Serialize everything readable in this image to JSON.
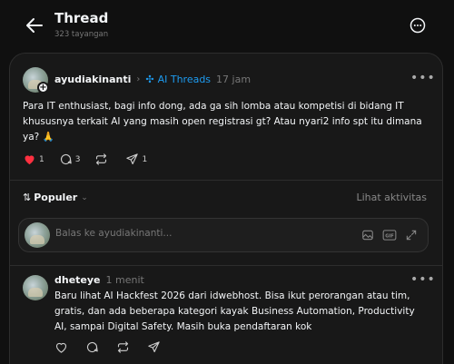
{
  "header": {
    "title": "Thread",
    "views": "323 tayangan"
  },
  "post": {
    "username": "ayudiakinanti",
    "topic": "AI Threads",
    "time": "17 jam",
    "text": "Para IT enthusiast, bagi info dong, ada ga sih lomba atau kompetisi di bidang IT khususnya terkait AI yang masih open registrasi gt? Atau nyari2 info spt itu dimana ya? 🙏",
    "likes": "1",
    "comments": "3",
    "shares": "1",
    "liked": true
  },
  "sort": {
    "label": "Populer",
    "activity": "Lihat aktivitas"
  },
  "reply_box": {
    "placeholder": "Balas ke ayudiakinanti..."
  },
  "reply": {
    "username": "dheteye",
    "time": "1 menit",
    "text": "Baru lihat AI Hackfest 2026 dari idwebhost. Bisa ikut perorangan atau tim, gratis, dan ada beberapa kategori kayak Business Automation, Productivity AI, sampai Digital Safety. Masih buka pendaftaran kok"
  },
  "colors": {
    "background": "#101010",
    "card": "#181818",
    "accent_blue": "#1d9bf0",
    "like_red": "#ff3040"
  },
  "icons": [
    "back-arrow-icon",
    "more-circle-icon",
    "more-dots-icon",
    "heart-icon",
    "comment-icon",
    "repost-icon",
    "share-icon",
    "sort-arrows-icon",
    "chevron-down-icon",
    "image-icon",
    "gif-icon",
    "expand-icon",
    "threads-topic-icon",
    "follow-plus-icon"
  ]
}
